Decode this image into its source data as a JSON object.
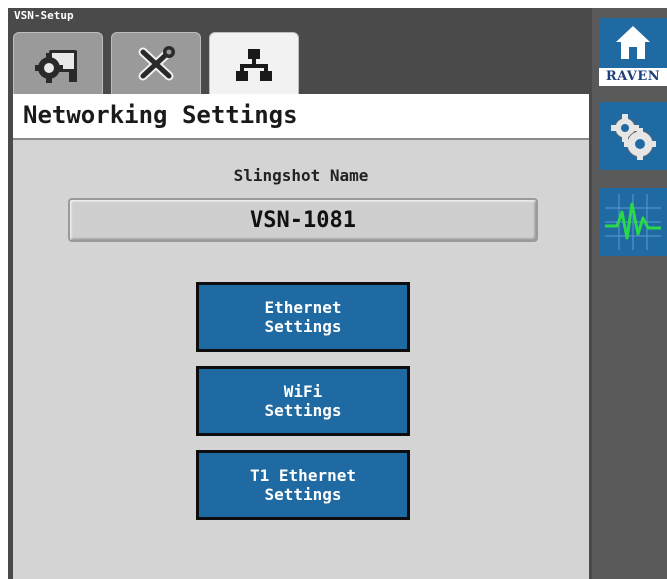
{
  "window": {
    "title": "VSN-Setup"
  },
  "tabs": [
    {
      "icon": "display-gear-icon",
      "active": false
    },
    {
      "icon": "tools-icon",
      "active": false
    },
    {
      "icon": "network-icon",
      "active": true
    }
  ],
  "page": {
    "title": "Networking Settings"
  },
  "slingshot": {
    "label": "Slingshot Name",
    "value": "VSN-1081"
  },
  "buttons": {
    "ethernet": "Ethernet\nSettings",
    "wifi": "WiFi\nSettings",
    "t1_ethernet": "T1 Ethernet\nSettings"
  },
  "rail": {
    "home_brand": "RAVEN",
    "items": [
      "home-icon",
      "gears-icon",
      "diagnostics-icon"
    ]
  },
  "colors": {
    "button_blue": "#1f6aa3",
    "panel_gray": "#d4d4d4",
    "rail_gray": "#595959"
  }
}
